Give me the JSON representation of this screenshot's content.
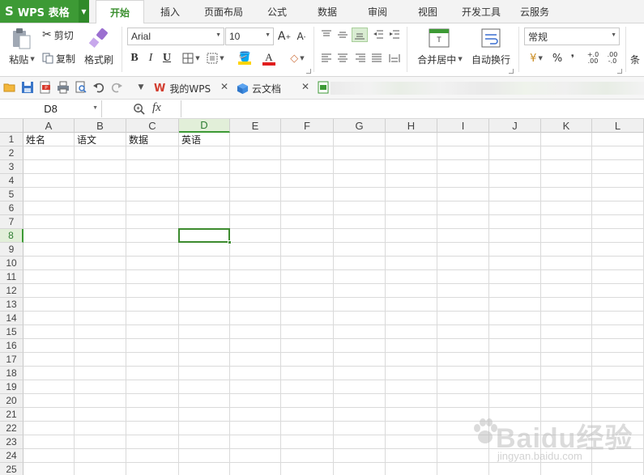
{
  "app": {
    "name": "WPS 表格",
    "logo": "S"
  },
  "tabs": [
    {
      "label": "开始",
      "active": true
    },
    {
      "label": "插入",
      "active": false
    },
    {
      "label": "页面布局",
      "active": false
    },
    {
      "label": "公式",
      "active": false
    },
    {
      "label": "数据",
      "active": false
    },
    {
      "label": "审阅",
      "active": false
    },
    {
      "label": "视图",
      "active": false
    },
    {
      "label": "开发工具",
      "active": false
    },
    {
      "label": "云服务",
      "active": false
    }
  ],
  "ribbon": {
    "paste_label": "粘贴",
    "cut_label": "剪切",
    "copy_label": "复制",
    "format_painter_label": "格式刷",
    "font_name": "Arial",
    "font_size": "10",
    "bold": "B",
    "italic": "I",
    "underline": "U",
    "merge_center_label": "合并居中",
    "wrap_text_label": "自动换行",
    "number_format": "常规",
    "percent": "%",
    "comma": "❜",
    "cond_format_partial": "条",
    "colors": {
      "fill": "#ffd400",
      "font": "#e11d1d",
      "accent": "#3d9a35"
    }
  },
  "quick_access": {
    "doc_tabs": [
      {
        "label": "我的WPS",
        "icon": "wps-logo-icon"
      },
      {
        "label": "云文档",
        "icon": "cloud-cube-icon"
      }
    ]
  },
  "formula_bar": {
    "name_box": "D8",
    "fx": "fx",
    "formula": ""
  },
  "sheet": {
    "columns": [
      "A",
      "B",
      "C",
      "D",
      "E",
      "F",
      "G",
      "H",
      "I",
      "J",
      "K",
      "L"
    ],
    "rows": [
      "1",
      "2",
      "3",
      "4",
      "5",
      "6",
      "7",
      "8",
      "9",
      "10",
      "11",
      "12",
      "13",
      "14",
      "15",
      "16",
      "17",
      "18",
      "19",
      "20",
      "21",
      "22",
      "23",
      "24",
      "25"
    ],
    "cells": {
      "A1": "姓名",
      "B1": "语文",
      "C1": "数据",
      "D1": "英语"
    },
    "active_cell": "D8",
    "selected_column": "D",
    "selected_row": "8"
  },
  "watermark": {
    "main": "Baidu经验",
    "sub": "jingyan.baidu.com"
  }
}
